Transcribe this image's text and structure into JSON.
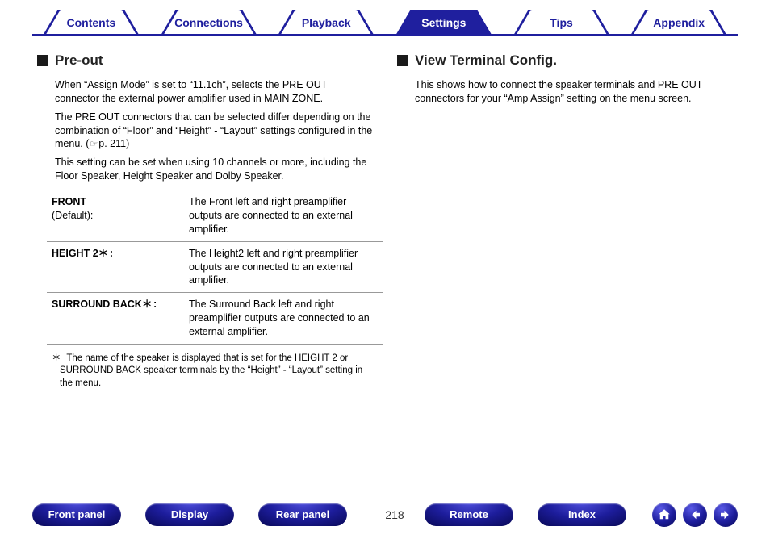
{
  "colors": {
    "brand": "#1f1f9e"
  },
  "tabs": [
    {
      "label": "Contents",
      "active": false
    },
    {
      "label": "Connections",
      "active": false
    },
    {
      "label": "Playback",
      "active": false
    },
    {
      "label": "Settings",
      "active": true
    },
    {
      "label": "Tips",
      "active": false
    },
    {
      "label": "Appendix",
      "active": false
    }
  ],
  "left": {
    "heading": "Pre-out",
    "para1": "When “Assign Mode” is set to “11.1ch”, selects the PRE OUT connector the external power amplifier used in MAIN ZONE.",
    "para2_pre": "The PRE OUT connectors that can be selected differ depending on the combination of “Floor” and “Height” - “Layout” settings configured in the menu.  (",
    "para2_ref": "p. 211",
    "para2_post": ")",
    "para3": "This setting can be set when using 10 channels or more, including the Floor Speaker, Height Speaker and Dolby Speaker.",
    "table": [
      {
        "label": "FRONT",
        "suffix": "",
        "note": "(Default):",
        "desc": "The Front left and right preamplifier outputs are connected to an external amplifier."
      },
      {
        "label": "HEIGHT 2",
        "suffix": "＊:",
        "note": "",
        "desc": "The Height2 left and right preamplifier outputs are connected to an external amplifier."
      },
      {
        "label": "SURROUND BACK",
        "suffix": "＊:",
        "note": "",
        "desc": "The Surround Back left and right preamplifier outputs are connected to an external amplifier."
      }
    ],
    "footnote_marker": "z",
    "footnote": "The name of the speaker is displayed that is set for the HEIGHT 2 or SURROUND BACK speaker terminals by the “Height” - “Layout” setting in the menu."
  },
  "right": {
    "heading": "View Terminal Config.",
    "para1": "This shows how to connect the speaker terminals and PRE OUT connectors for your “Amp Assign” setting on the menu screen."
  },
  "bottom": {
    "buttons": [
      "Front panel",
      "Display",
      "Rear panel"
    ],
    "page": "218",
    "buttons2": [
      "Remote",
      "Index"
    ],
    "nav_icons": [
      "home-icon",
      "prev-icon",
      "next-icon"
    ]
  }
}
